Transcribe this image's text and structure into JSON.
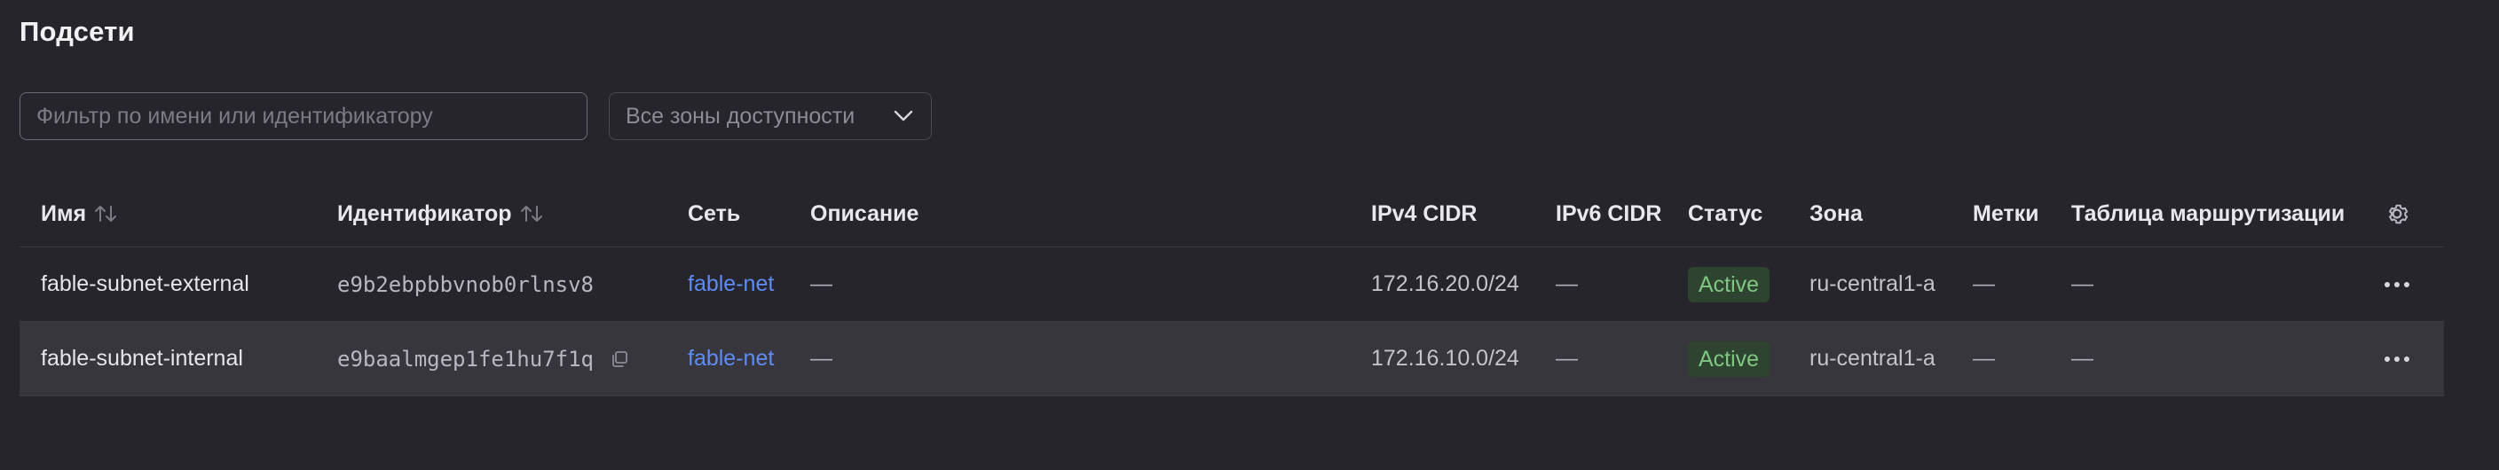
{
  "page": {
    "title": "Подсети"
  },
  "filters": {
    "search_placeholder": "Фильтр по имени или идентификатору",
    "search_value": "",
    "zone_label": "Все зоны доступности"
  },
  "table": {
    "headers": {
      "name": "Имя",
      "id": "Идентификатор",
      "network": "Сеть",
      "description": "Описание",
      "ipv4": "IPv4 CIDR",
      "ipv6": "IPv6 CIDR",
      "status": "Статус",
      "zone": "Зона",
      "labels": "Метки",
      "route_table": "Таблица маршрутизации"
    },
    "rows": [
      {
        "name": "fable-subnet-external",
        "id": "e9b2ebpbbvnob0rlnsv8",
        "network": "fable-net",
        "description": "—",
        "ipv4": "172.16.20.0/24",
        "ipv6": "—",
        "status": "Active",
        "zone": "ru-central1-a",
        "labels": "—",
        "route_table": "—"
      },
      {
        "name": "fable-subnet-internal",
        "id": "e9baalmgep1fe1hu7f1q",
        "network": "fable-net",
        "description": "—",
        "ipv4": "172.16.10.0/24",
        "ipv6": "—",
        "status": "Active",
        "zone": "ru-central1-a",
        "labels": "—",
        "route_table": "—"
      }
    ]
  },
  "colors": {
    "background": "#26252b",
    "link": "#5e8cf4",
    "status_active_text": "#7ec883",
    "status_active_bg": "#2e4430",
    "hover_row": "#37363c"
  },
  "icons": {
    "sort": "sort-arrows-icon",
    "copy": "copy-icon",
    "more": "more-horizontal-icon",
    "settings": "gear-icon",
    "dropdown": "chevron-down-icon"
  }
}
